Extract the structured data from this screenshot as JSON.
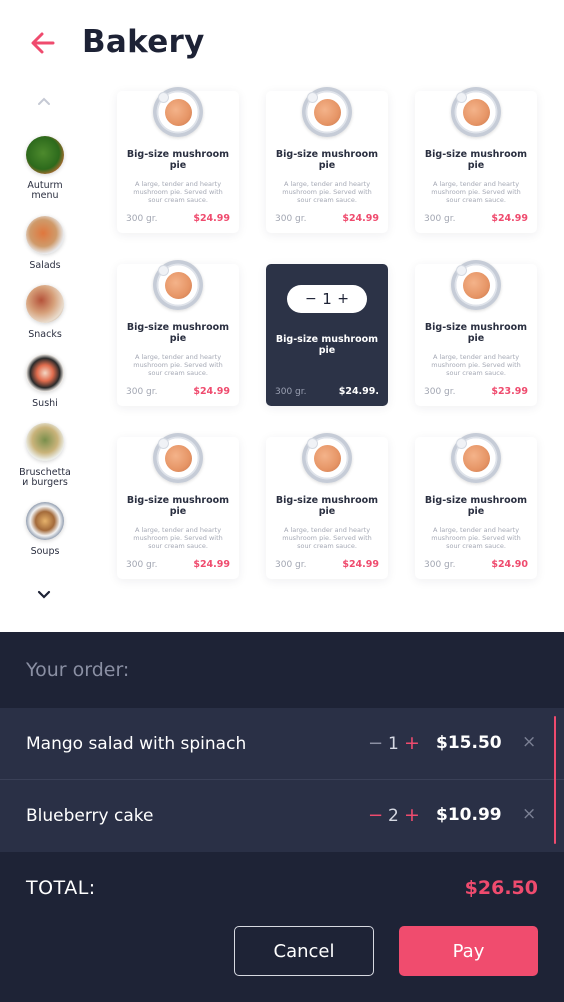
{
  "header": {
    "title": "Bakery"
  },
  "sidebar": {
    "categories": [
      {
        "label": "Auturm\nmenu",
        "icon": "salad-bowl-icon"
      },
      {
        "label": "Salads",
        "icon": "salad-plate-icon"
      },
      {
        "label": "Snacks",
        "icon": "snacks-icon"
      },
      {
        "label": "Sushi",
        "icon": "sushi-icon"
      },
      {
        "label": "Bruschetta\nи burgers",
        "icon": "bruschetta-icon"
      },
      {
        "label": "Soups",
        "icon": "soup-icon"
      }
    ]
  },
  "products": [
    {
      "title": "Big-size mushroom pie",
      "desc": "A large, tender and hearty mushroom pie. Served with sour cream sauce.",
      "weight": "300 gr.",
      "price": "$24.99"
    },
    {
      "title": "Big-size mushroom pie",
      "desc": "A large, tender and hearty mushroom pie. Served with sour cream sauce.",
      "weight": "300 gr.",
      "price": "$24.99"
    },
    {
      "title": "Big-size mushroom pie",
      "desc": "A large, tender and hearty mushroom pie. Served with sour cream sauce.",
      "weight": "300 gr.",
      "price": "$24.99"
    },
    {
      "title": "Big-size mushroom pie",
      "desc": "A large, tender and hearty mushroom pie. Served with sour cream sauce.",
      "weight": "300 gr.",
      "price": "$24.99"
    },
    {
      "title": "Big-size mushroom pie",
      "desc": "",
      "weight": "300 gr.",
      "price": "$24.99.",
      "selected": true,
      "qty": "1"
    },
    {
      "title": "Big-size mushroom pie",
      "desc": "A large, tender and hearty mushroom pie. Served with sour cream sauce.",
      "weight": "300 gr.",
      "price": "$23.99"
    },
    {
      "title": "Big-size mushroom pie",
      "desc": "A large, tender and hearty mushroom pie. Served with sour cream sauce.",
      "weight": "300 gr.",
      "price": "$24.99"
    },
    {
      "title": "Big-size mushroom pie",
      "desc": "A large, tender and hearty mushroom pie. Served with sour cream sauce.",
      "weight": "300 gr.",
      "price": "$24.99"
    },
    {
      "title": "Big-size mushroom pie",
      "desc": "A large, tender and hearty mushroom pie. Served with sour cream sauce.",
      "weight": "300 gr.",
      "price": "$24.90"
    }
  ],
  "order": {
    "heading": "Your order:",
    "items": [
      {
        "name": "Mango salad with spinach",
        "minus": "−",
        "qty": "1",
        "plus": "+",
        "price": "$15.50",
        "remove": "×"
      },
      {
        "name": "Blueberry cake",
        "minus": "−",
        "qty": "2",
        "plus": "+",
        "price": "$10.99",
        "remove": "×"
      }
    ],
    "total_label": "TOTAL:",
    "total_value": "$26.50",
    "cancel_label": "Cancel",
    "pay_label": "Pay"
  },
  "colors": {
    "accent": "#ef4b6e",
    "dark": "#1e2336",
    "card_dark": "#2c3347"
  }
}
